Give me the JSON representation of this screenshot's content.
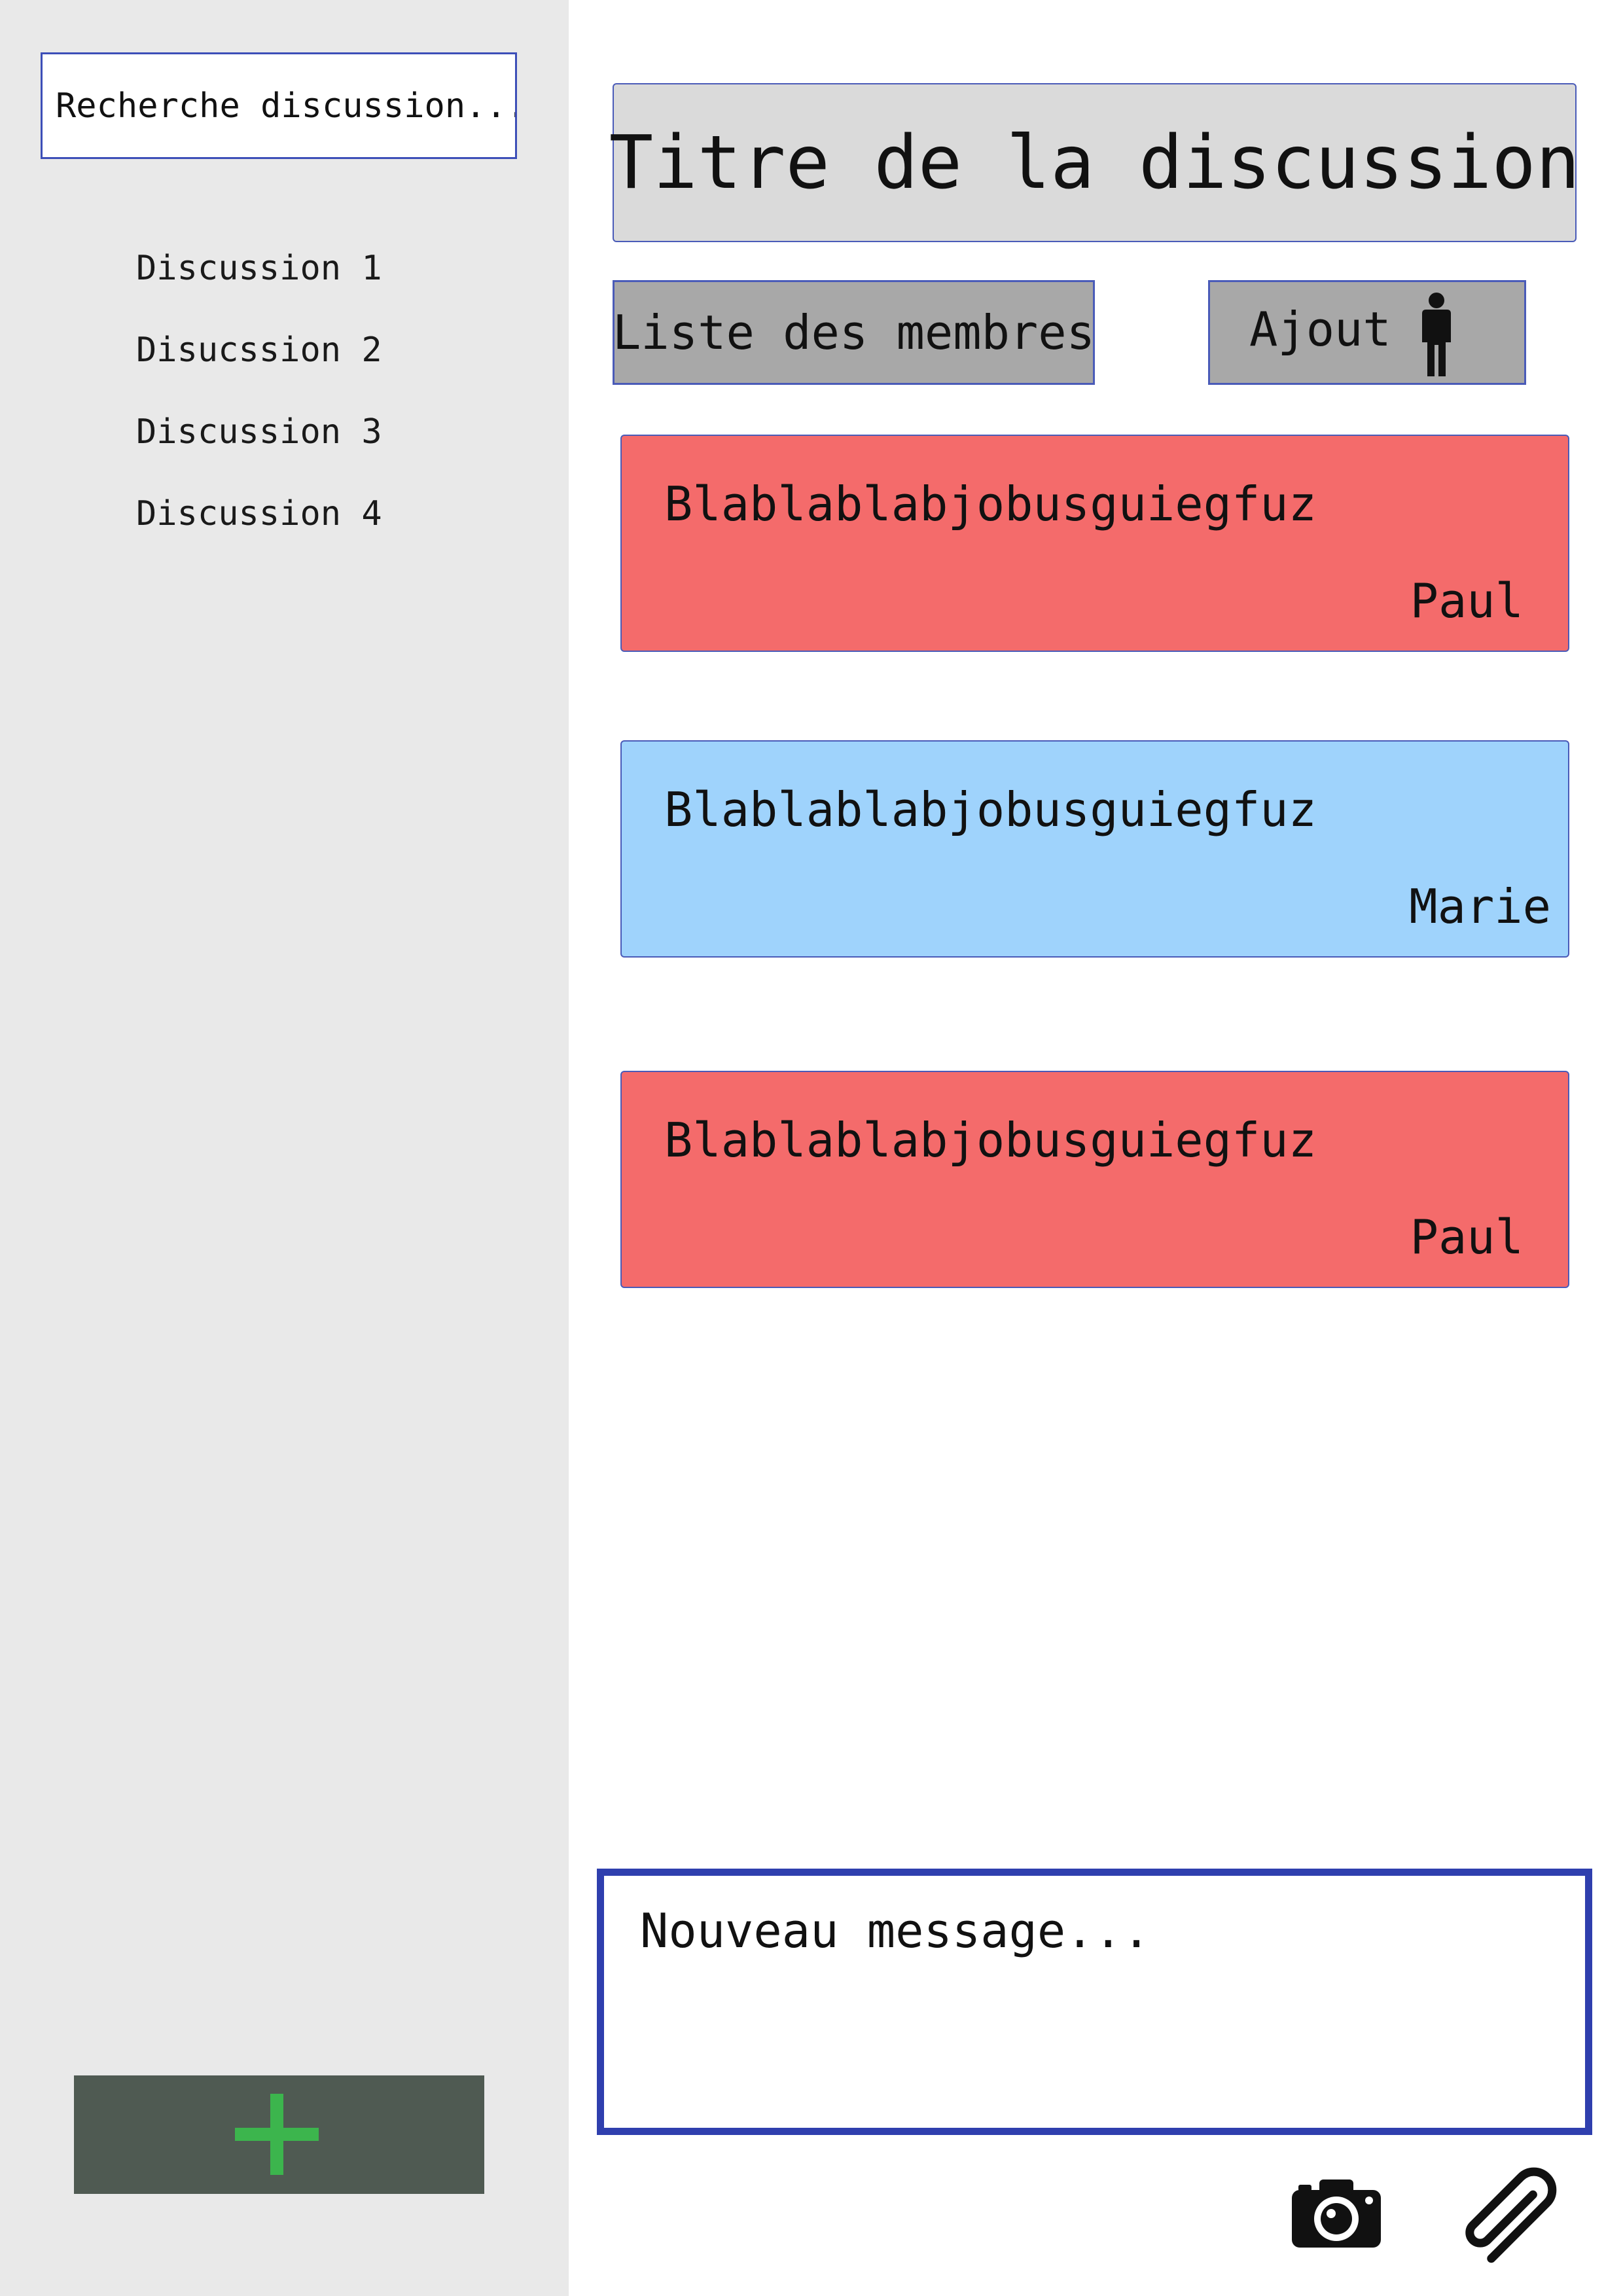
{
  "sidebar": {
    "search_placeholder": "Recherche discussion...",
    "conversations": [
      {
        "label": "Discussion 1"
      },
      {
        "label": "Disucssion 2"
      },
      {
        "label": "Discussion 3"
      },
      {
        "label": "Discussion 4"
      }
    ],
    "new_conversation_icon": "plus-icon",
    "new_conversation_icon_color": "#3cb54d"
  },
  "header": {
    "title": "Titre de la discussion",
    "members_label": "Liste des membres",
    "add_label": "Ajout",
    "add_icon": "person-icon"
  },
  "messages": [
    {
      "text": "Blablablabjobusguiegfuz",
      "author": "Paul",
      "color": "#f46b6b"
    },
    {
      "text": "Blablablabjobusguiegfuz",
      "author": "Marie",
      "color": "#9fd3fc"
    },
    {
      "text": "Blablablabjobusguiegfuz",
      "author": "Paul",
      "color": "#f46b6b"
    }
  ],
  "composer": {
    "placeholder": "Nouveau message...",
    "camera_icon": "camera-icon",
    "attach_icon": "paperclip-icon"
  },
  "colors": {
    "sidebar_bg": "#e9e9e9",
    "border_accent": "#2f3fae",
    "title_bg": "#dadada",
    "button_bg": "#a8a8a8",
    "new_conversation_bg": "#4f5a52"
  }
}
